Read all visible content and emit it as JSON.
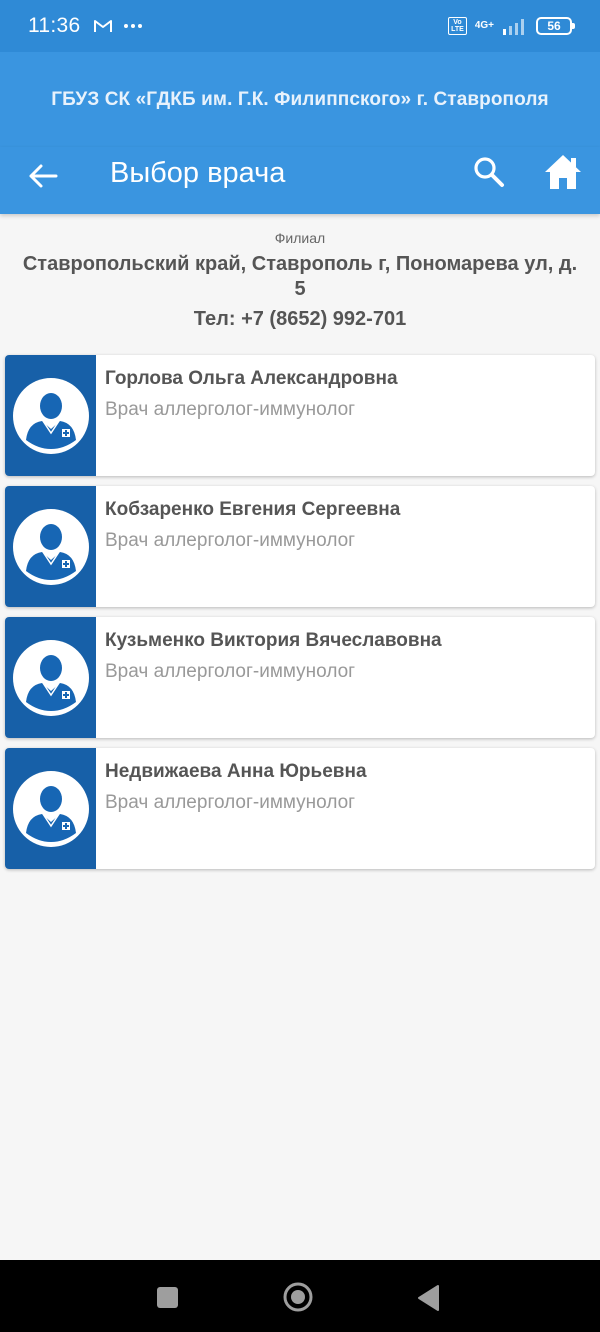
{
  "status_bar": {
    "time": "11:36",
    "volte_top": "Vo",
    "volte_bottom": "LTE",
    "network": "4G+",
    "battery": "56",
    "icons": [
      "gmail-icon",
      "more-dots-icon",
      "volte-icon",
      "signal-icon",
      "battery-icon"
    ]
  },
  "org_title": "ГБУЗ СК «ГДКБ им. Г.К. Филиппского» г. Ставрополя",
  "toolbar": {
    "title": "Выбор врача",
    "back_icon": "arrow-left-icon",
    "search_icon": "search-icon",
    "home_icon": "home-icon"
  },
  "branch": {
    "label": "Филиал",
    "address": "Ставропольский край, Ставрополь г, Пономарева ул, д. 5",
    "phone": "Тел: +7 (8652) 992-701"
  },
  "doctors": [
    {
      "name": "Горлова Ольга Александровна",
      "specialty": "Врач аллерголог-иммунолог"
    },
    {
      "name": "Кобзаренко Евгения Сергеевна",
      "specialty": "Врач аллерголог-иммунолог"
    },
    {
      "name": "Кузьменко Виктория Вячеславовна",
      "specialty": "Врач аллерголог-иммунолог"
    },
    {
      "name": "Недвижаева Анна Юрьевна",
      "specialty": "Врач аллерголог-иммунолог"
    }
  ],
  "colors": {
    "status_bar": "#2f8ad6",
    "app_bar": "#3a95e0",
    "avatar_bg": "#1760a8",
    "page_bg": "#f6f6f6"
  }
}
